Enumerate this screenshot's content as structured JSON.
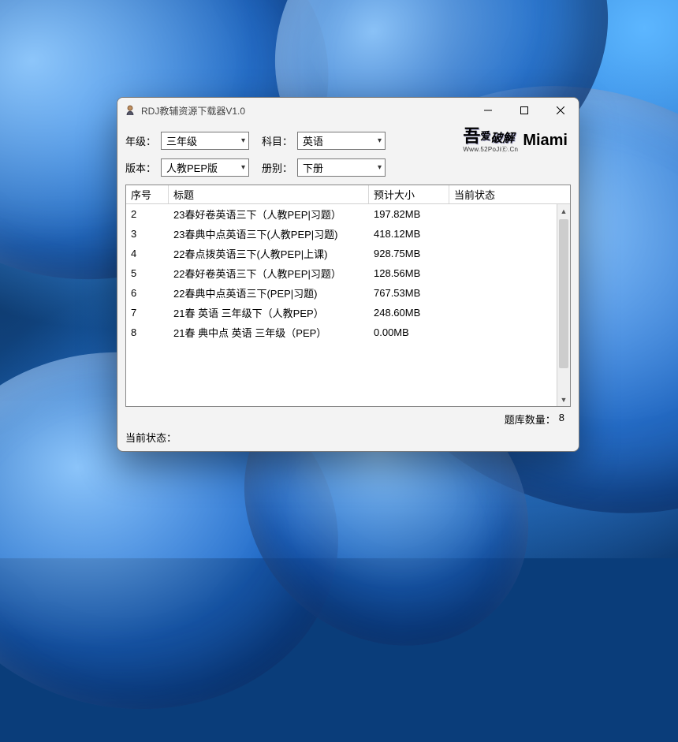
{
  "window": {
    "title": "RDJ教辅资源下载器V1.0"
  },
  "filters": {
    "grade_label": "年级：",
    "grade_value": "三年级",
    "subject_label": "科目：",
    "subject_value": "英语",
    "edition_label": "版本：",
    "edition_value": "人教PEP版",
    "volume_label": "册别：",
    "volume_value": "下册"
  },
  "brand": {
    "logo_top": "吾爱破解",
    "logo_sub": "Www.52PoJiⒺ.Cn",
    "name": "Miami"
  },
  "table": {
    "headers": {
      "num": "序号",
      "title": "标题",
      "size": "预计大小",
      "state": "当前状态"
    },
    "rows": [
      {
        "num": "2",
        "title": "23春好卷英语三下（人教PEP|习题）",
        "size": "197.82MB",
        "state": ""
      },
      {
        "num": "3",
        "title": "23春典中点英语三下(人教PEP|习题)",
        "size": "418.12MB",
        "state": ""
      },
      {
        "num": "4",
        "title": "22春点拨英语三下(人教PEP|上课)",
        "size": "928.75MB",
        "state": ""
      },
      {
        "num": "5",
        "title": "22春好卷英语三下（人教PEP|习题）",
        "size": "128.56MB",
        "state": ""
      },
      {
        "num": "6",
        "title": "22春典中点英语三下(PEP|习题)",
        "size": "767.53MB",
        "state": ""
      },
      {
        "num": "7",
        "title": "21春 英语 三年级下（人教PEP）",
        "size": "248.60MB",
        "state": ""
      },
      {
        "num": "8",
        "title": "21春 典中点 英语 三年级（PEP）",
        "size": "0.00MB",
        "state": ""
      }
    ]
  },
  "footer": {
    "count_label": "题库数量：",
    "count_value": "8"
  },
  "status": {
    "label": "当前状态：",
    "value": ""
  }
}
